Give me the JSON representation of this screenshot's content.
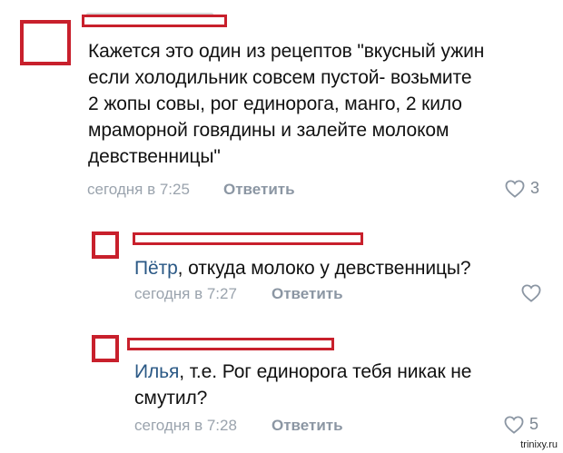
{
  "comments": [
    {
      "text": "Кажется это один из рецептов \"вкусный ужин если холодильник совсем пустой- возьмите 2 жопы совы, рог единорога, манго, 2 кило мраморной говядины и залейте молоком девственницы\"",
      "lines": [
        "Кажется это один из рецептов \"вкусный ужин",
        "если холодильник совсем пустой- возьмите",
        "2 жопы совы, рог единорога, манго, 2 кило",
        "мраморной говядины и залейте молоком",
        "девственницы\""
      ],
      "time": "сегодня в 7:25",
      "reply_label": "Ответить",
      "likes": "3"
    },
    {
      "mention": "Пётр",
      "text_after_mention": ", откуда молоко у девственницы?",
      "time": "сегодня в 7:27",
      "reply_label": "Ответить",
      "likes": ""
    },
    {
      "mention": "Илья",
      "line1_after_mention": ", т.е. Рог единорога тебя никак не",
      "line2": "смутил?",
      "time": "сегодня в 7:28",
      "reply_label": "Ответить",
      "likes": "5"
    }
  ],
  "watermark": "trinixy.ru",
  "colors": {
    "redaction": "#c8202c",
    "mention": "#2a5885",
    "meta": "#9aa3ad"
  }
}
